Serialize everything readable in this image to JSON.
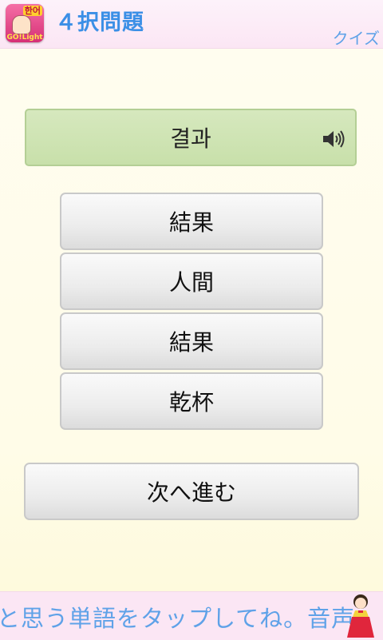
{
  "header": {
    "title": "４択問題",
    "subtitle": "クイズ",
    "icon": {
      "name": "app-icon",
      "badge_top": "한어",
      "badge_bottom": "GO!Light"
    }
  },
  "question": {
    "word": "결과",
    "audio_icon": "speaker-icon"
  },
  "choices": [
    {
      "label": "結果"
    },
    {
      "label": "人間"
    },
    {
      "label": "結果"
    },
    {
      "label": "乾杯"
    }
  ],
  "next_button": {
    "label": "次へ進む"
  },
  "banner": {
    "text": "と思う単語をタップしてね。音声"
  },
  "colors": {
    "accent_blue": "#3b8fe6",
    "question_bg": "#d6e8be",
    "header_bg": "#fbe6f4"
  }
}
